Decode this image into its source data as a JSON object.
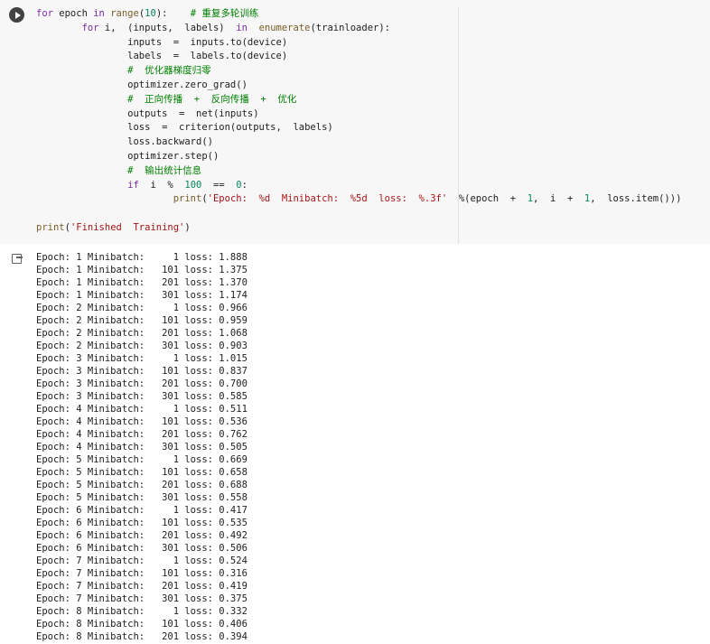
{
  "code_cell": {
    "line1": {
      "kw_for": "for",
      "a": " epoch ",
      "kw_in": "in",
      "b": " ",
      "fn_range": "range",
      "c": "(",
      "num": "10",
      "d": "):    ",
      "comment": "# 重复多轮训练"
    },
    "line2": {
      "indent": "        ",
      "kw_for": "for",
      "a": " i,  (inputs,  labels)  ",
      "kw_in": "in",
      "b": "  ",
      "fn_enumerate": "enumerate",
      "c": "(trainloader):"
    },
    "line3": "                inputs  =  inputs.to(device)",
    "line4": "                labels  =  labels.to(device)",
    "line5": {
      "indent": "                ",
      "comment": "#  优化器梯度归零"
    },
    "line6": "                optimizer.zero_grad()",
    "line7": {
      "indent": "                ",
      "comment": "#  正向传播  +  反向传播  +  优化"
    },
    "line8": "                outputs  =  net(inputs)",
    "line9": "                loss  =  criterion(outputs,  labels)",
    "line10": "                loss.backward()",
    "line11": "                optimizer.step()",
    "line12": {
      "indent": "                ",
      "comment": "#  输出统计信息"
    },
    "line13": {
      "indent": "                ",
      "kw_if": "if",
      "a": "  i  %  ",
      "num1": "100",
      "b": "  ==  ",
      "num2": "0",
      "c": ":"
    },
    "line14": {
      "indent": "                        ",
      "fn_print": "print",
      "a": "(",
      "str": "'Epoch:  %d  Minibatch:  %5d  loss:  %.3f'",
      "b": "  %(epoch  +  ",
      "num1": "1",
      "c": ",  i  +  ",
      "num2": "1",
      "d": ",  loss.item()))"
    },
    "line16": {
      "fn_print": "print",
      "a": "(",
      "str": "'Finished  Training'",
      "b": ")"
    }
  },
  "output_lines": [
    "Epoch: 1 Minibatch:     1 loss: 1.888",
    "Epoch: 1 Minibatch:   101 loss: 1.375",
    "Epoch: 1 Minibatch:   201 loss: 1.370",
    "Epoch: 1 Minibatch:   301 loss: 1.174",
    "Epoch: 2 Minibatch:     1 loss: 0.966",
    "Epoch: 2 Minibatch:   101 loss: 0.959",
    "Epoch: 2 Minibatch:   201 loss: 1.068",
    "Epoch: 2 Minibatch:   301 loss: 0.903",
    "Epoch: 3 Minibatch:     1 loss: 1.015",
    "Epoch: 3 Minibatch:   101 loss: 0.837",
    "Epoch: 3 Minibatch:   201 loss: 0.700",
    "Epoch: 3 Minibatch:   301 loss: 0.585",
    "Epoch: 4 Minibatch:     1 loss: 0.511",
    "Epoch: 4 Minibatch:   101 loss: 0.536",
    "Epoch: 4 Minibatch:   201 loss: 0.762",
    "Epoch: 4 Minibatch:   301 loss: 0.505",
    "Epoch: 5 Minibatch:     1 loss: 0.669",
    "Epoch: 5 Minibatch:   101 loss: 0.658",
    "Epoch: 5 Minibatch:   201 loss: 0.688",
    "Epoch: 5 Minibatch:   301 loss: 0.558",
    "Epoch: 6 Minibatch:     1 loss: 0.417",
    "Epoch: 6 Minibatch:   101 loss: 0.535",
    "Epoch: 6 Minibatch:   201 loss: 0.492",
    "Epoch: 6 Minibatch:   301 loss: 0.506",
    "Epoch: 7 Minibatch:     1 loss: 0.524",
    "Epoch: 7 Minibatch:   101 loss: 0.316",
    "Epoch: 7 Minibatch:   201 loss: 0.419",
    "Epoch: 7 Minibatch:   301 loss: 0.375",
    "Epoch: 8 Minibatch:     1 loss: 0.332",
    "Epoch: 8 Minibatch:   101 loss: 0.406",
    "Epoch: 8 Minibatch:   201 loss: 0.394"
  ],
  "icons": {
    "run": "play-circle-icon",
    "output": "output-arrow-icon"
  }
}
